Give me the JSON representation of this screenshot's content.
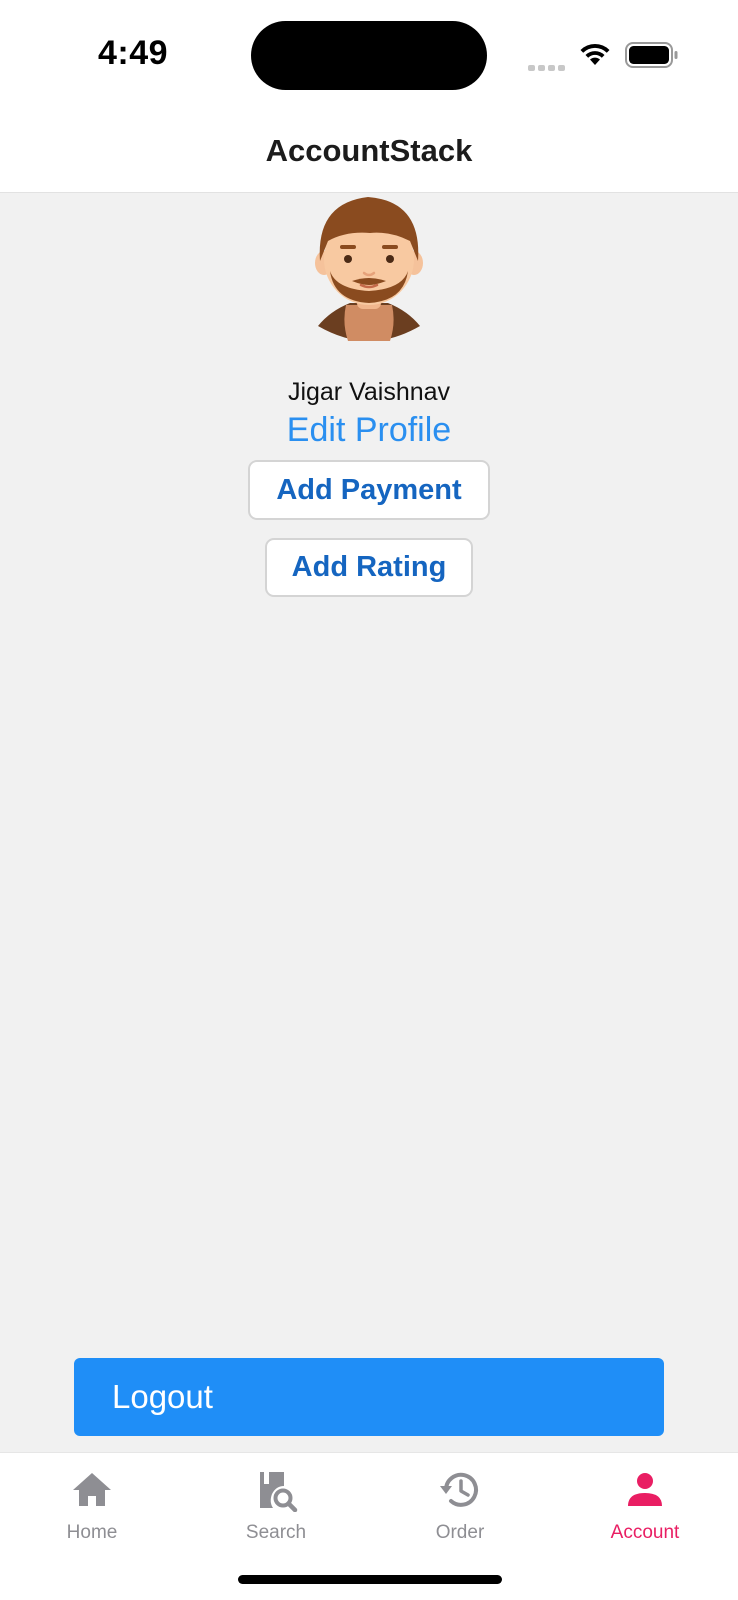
{
  "status_bar": {
    "time": "4:49"
  },
  "header": {
    "title": "AccountStack"
  },
  "profile": {
    "name": "Jigar Vaishnav",
    "edit_label": "Edit Profile"
  },
  "actions": {
    "add_payment": "Add Payment",
    "add_rating": "Add Rating",
    "logout": "Logout"
  },
  "tabs": [
    {
      "label": "Home",
      "icon": "home-icon"
    },
    {
      "label": "Search",
      "icon": "search-book-icon"
    },
    {
      "label": "Order",
      "icon": "history-icon"
    },
    {
      "label": "Account",
      "icon": "person-icon",
      "active": true
    }
  ],
  "colors": {
    "accent": "#1f8ef7",
    "link": "#2a8ff0",
    "button_text": "#1565c0",
    "tab_active": "#e91e63",
    "tab_inactive": "#8e8e93"
  }
}
